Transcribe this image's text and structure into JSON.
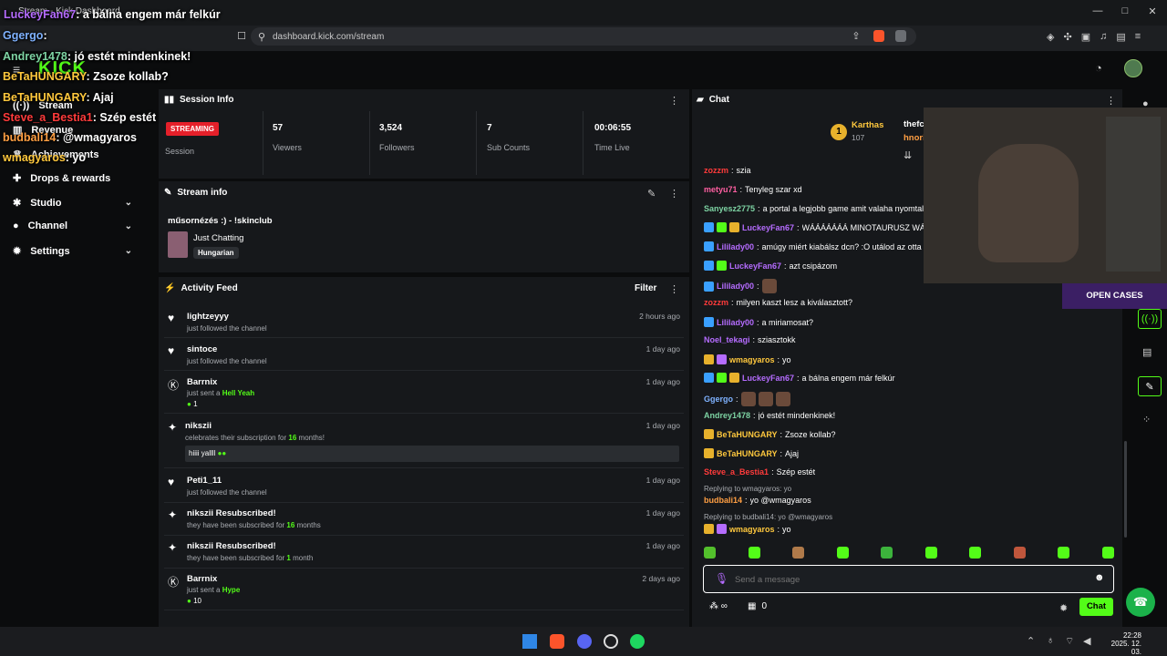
{
  "browser": {
    "tab_title": "Stream - Kick Dashboard",
    "url": "dashboard.kick.com/stream"
  },
  "logo": "KICK",
  "sidebar": {
    "items": [
      {
        "label": "Stream",
        "icon": "broadcast-icon"
      },
      {
        "label": "Revenue",
        "icon": "revenue-icon"
      },
      {
        "label": "Achievements",
        "icon": "trophy-icon"
      },
      {
        "label": "Drops & rewards",
        "icon": "gift-icon"
      },
      {
        "label": "Studio",
        "icon": "studio-icon"
      },
      {
        "label": "Channel",
        "icon": "user-icon"
      },
      {
        "label": "Settings",
        "icon": "gear-icon"
      }
    ]
  },
  "session": {
    "title": "Session Info",
    "status": "STREAMING",
    "status_label": "Session",
    "stats": [
      {
        "value": "57",
        "label": "Viewers"
      },
      {
        "value": "3,524",
        "label": "Followers"
      },
      {
        "value": "7",
        "label": "Sub Counts"
      },
      {
        "value": "00:06:55",
        "label": "Time Live"
      }
    ]
  },
  "stream_info": {
    "title": "Stream info",
    "stream_title": "műsornézés :) - !skinclub",
    "category": "Just Chatting",
    "tag": "Hungarian"
  },
  "activity": {
    "title": "Activity Feed",
    "filter": "Filter",
    "items": [
      {
        "user": "lightzeyyy",
        "action": "just followed the channel",
        "time": "2 hours ago",
        "icon": "heart-icon"
      },
      {
        "user": "sintoce",
        "action": "just followed the channel",
        "time": "1 day ago",
        "icon": "heart-icon"
      },
      {
        "user": "Barrnix",
        "action": "just sent a",
        "action_item": "Hell Yeah",
        "count": "1",
        "time": "1 day ago",
        "icon": "kick-icon"
      },
      {
        "user": "nikszii",
        "action": "celebrates their subscription for",
        "months": "16",
        "months_suffix": "months!",
        "message": "hiiii yallll",
        "time": "1 day ago",
        "icon": "party-icon"
      },
      {
        "user": "Peti1_11",
        "action": "just followed the channel",
        "time": "1 day ago",
        "icon": "heart-icon"
      },
      {
        "user": "nikszii Resubscribed!",
        "action": "they have been subscribed for",
        "months": "16",
        "months_suffix": "months",
        "time": "1 day ago",
        "icon": "sparkle-icon"
      },
      {
        "user": "nikszii Resubscribed!",
        "action": "they have been subscribed for",
        "months": "1",
        "months_suffix": "month",
        "time": "1 day ago",
        "icon": "sparkle-icon"
      },
      {
        "user": "Barrnix",
        "action": "just sent a",
        "action_item": "Hype",
        "count": "10",
        "time": "2 days ago",
        "icon": "kick-icon"
      }
    ]
  },
  "chat": {
    "title": "Chat",
    "pinned": {
      "user": "Karthas",
      "count": "107",
      "other": "thefc",
      "other2": "hnori"
    },
    "messages": [
      {
        "user": "zozzm",
        "color": "#ff3b3b",
        "text": "szia"
      },
      {
        "user": "metyu71",
        "color": "#ff5fa2",
        "text": "Tenyleg szar xd"
      },
      {
        "user": "Sanyesz2775",
        "color": "#7dd3a3",
        "text": "a portal a legjobb game amit valaha nyomtal"
      },
      {
        "user": "LuckeyFan67",
        "color": "#b56cff",
        "text": "WÁÁÁÁÁÁÁ MINOTAURUSZ WÁÁ"
      },
      {
        "user": "Lililady00",
        "color": "#b56cff",
        "text": "amúgy miért kiabálsz dcn? :O utálod az otta"
      },
      {
        "user": "LuckeyFan67",
        "color": "#b56cff",
        "text": "azt csipázom"
      },
      {
        "user": "Lililady00",
        "color": "#b56cff",
        "text": ""
      },
      {
        "user": "zozzm",
        "color": "#ff3b3b",
        "text": "milyen kaszt lesz a kiválasztott?"
      },
      {
        "user": "Lililady00",
        "color": "#b56cff",
        "text": "a miriamosat?"
      },
      {
        "user": "Noel_tekagi",
        "color": "#b56cff",
        "text": "sziasztokk"
      },
      {
        "user": "wmagyaros",
        "color": "#ffc83d",
        "text": "yo"
      },
      {
        "user": "LuckeyFan67",
        "color": "#b56cff",
        "text": "a bálna engem már felkúr"
      },
      {
        "user": "Ggergo",
        "color": "#7fb2ff",
        "text": ""
      },
      {
        "user": "Andrey1478",
        "color": "#7dd3a3",
        "text": "jó estét mindenkinek!"
      },
      {
        "user": "BeTaHUNGARY",
        "color": "#ffc83d",
        "text": "Zsoze kollab?"
      },
      {
        "user": "BeTaHUNGARY",
        "color": "#ffc83d",
        "text": "Ajaj"
      },
      {
        "user": "Steve_a_Bestia1",
        "color": "#ff3b3b",
        "text": "Szép estét"
      },
      {
        "user": "budbali14",
        "color": "#ff9f43",
        "text": "yo @wmagyaros",
        "reply": "Replying to wmagyaros: yo"
      },
      {
        "user": "wmagyaros",
        "color": "#ffc83d",
        "text": "yo",
        "reply": "Replying to budbali14: yo @wmagyaros"
      }
    ],
    "input_placeholder": "Send a message",
    "points": "0",
    "send_label": "Chat"
  },
  "webcam": {
    "open_cases": "OPEN CASES"
  },
  "overlay": [
    {
      "user": "LuckeyFan67",
      "color": "#b56cff",
      "text": ": a bálna engem már felkúr"
    },
    {
      "user": "Ggergo",
      "color": "#7fb2ff",
      "text": ":"
    },
    {
      "user": "Andrey1478",
      "color": "#7dd3a3",
      "text": ": jó estét mindenkinek!"
    },
    {
      "user": "BeTaHUNGARY",
      "color": "#ffc83d",
      "text": ": Zsoze kollab?"
    },
    {
      "user": "BeTaHUNGARY",
      "color": "#ffc83d",
      "text": ": Ajaj"
    },
    {
      "user": "Steve_a_Bestia1",
      "color": "#ff3b3b",
      "text": ": Szép estét"
    },
    {
      "user": "budbali14",
      "color": "#ff9f43",
      "text": ":     @wmagyaros"
    },
    {
      "user": "wmagyaros",
      "color": "#ffc83d",
      "text": ": yo"
    }
  ],
  "taskbar": {
    "time": "22:28",
    "date": "2025. 12. 03."
  }
}
